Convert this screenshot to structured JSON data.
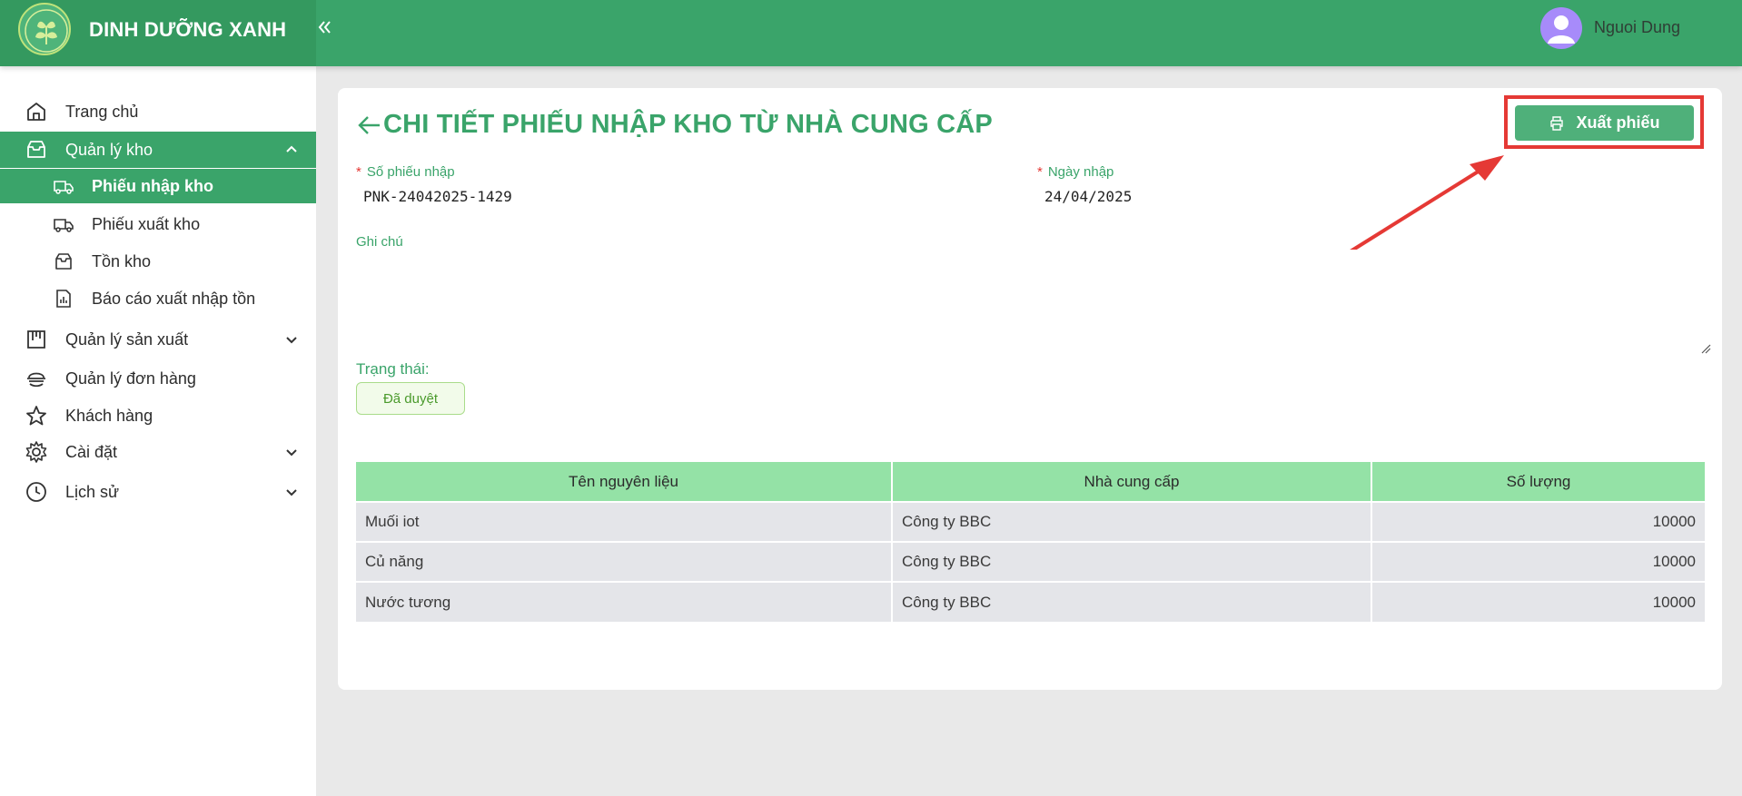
{
  "header": {
    "brand": "DINH DƯỠNG XANH",
    "collapse_icon": "double-chevron-left-icon",
    "user_name": "Nguoi Dung"
  },
  "sidebar": {
    "items": [
      {
        "label": "Trang chủ",
        "icon": "home-icon"
      },
      {
        "label": "Quản lý kho",
        "icon": "inbox-icon",
        "expanded": true
      },
      {
        "label": "Quản lý sản xuất",
        "icon": "factory-icon"
      },
      {
        "label": "Quản lý đơn hàng",
        "icon": "order-icon"
      },
      {
        "label": "Khách hàng",
        "icon": "star-icon"
      },
      {
        "label": "Cài đặt",
        "icon": "gear-icon"
      },
      {
        "label": "Lịch sử",
        "icon": "history-icon"
      }
    ],
    "warehouse_sub": [
      {
        "label": "Phiếu nhập kho",
        "icon": "truck-in-icon",
        "active": true
      },
      {
        "label": "Phiếu xuất kho",
        "icon": "truck-out-icon"
      },
      {
        "label": "Tồn kho",
        "icon": "inbox-icon"
      },
      {
        "label": "Báo cáo xuất nhập tồn",
        "icon": "report-icon"
      }
    ]
  },
  "main": {
    "title": "CHI TIẾT PHIẾU NHẬP KHO TỪ NHÀ CUNG CẤP",
    "export_button": "Xuất phiếu",
    "receipt_no_label": "Số phiếu nhập",
    "receipt_no_value": "PNK-24042025-1429",
    "date_label": "Ngày nhập",
    "date_value": "24/04/2025",
    "note_label": "Ghi chú",
    "note_value": "",
    "status_label": "Trạng thái:",
    "status_value": "Đã duyệt",
    "table": {
      "headers": [
        "Tên nguyên liệu",
        "Nhà cung cấp",
        "Số lượng"
      ],
      "rows": [
        [
          "Muối iot",
          "Công ty BBC",
          "10000"
        ],
        [
          "Củ năng",
          "Công ty BBC",
          "10000"
        ],
        [
          "Nước tương",
          "Công ty BBC",
          "10000"
        ]
      ]
    }
  },
  "colors": {
    "primary": "#3aa46a",
    "table_header": "#94e2a6",
    "annotation": "#e53935"
  }
}
